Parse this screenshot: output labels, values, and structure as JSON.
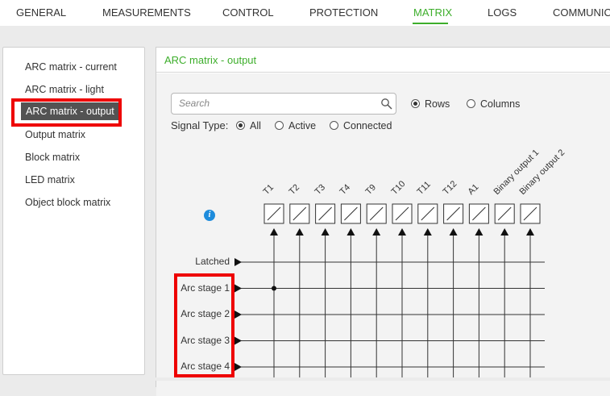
{
  "top_tabs": [
    {
      "label": "GENERAL",
      "active": false
    },
    {
      "label": "MEASUREMENTS",
      "active": false
    },
    {
      "label": "CONTROL",
      "active": false
    },
    {
      "label": "PROTECTION",
      "active": false
    },
    {
      "label": "MATRIX",
      "active": true
    },
    {
      "label": "LOGS",
      "active": false
    },
    {
      "label": "COMMUNICA",
      "active": false
    }
  ],
  "sidebar": {
    "items": [
      {
        "label": "ARC matrix - current"
      },
      {
        "label": "ARC matrix - light"
      },
      {
        "label": "ARC matrix - output",
        "selected": true
      },
      {
        "label": "Output matrix"
      },
      {
        "label": "Block matrix"
      },
      {
        "label": "LED matrix"
      },
      {
        "label": "Object block matrix"
      }
    ]
  },
  "panel": {
    "title": "ARC matrix - output"
  },
  "search": {
    "placeholder": "Search",
    "value": ""
  },
  "view_options": {
    "rows_label": "Rows",
    "columns_label": "Columns",
    "selected": "Rows"
  },
  "signal_type": {
    "label": "Signal Type:",
    "options": [
      "All",
      "Active",
      "Connected"
    ],
    "selected": "All"
  },
  "matrix": {
    "columns": [
      "T1",
      "T2",
      "T3",
      "T4",
      "T9",
      "T10",
      "T11",
      "T12",
      "A1",
      "Binary output 1",
      "Binary output 2"
    ],
    "rows": [
      "Latched",
      "Arc stage 1",
      "Arc stage 2",
      "Arc stage 3",
      "Arc stage 4"
    ],
    "connections": [
      {
        "row": "Arc stage 1",
        "column": "T1"
      }
    ]
  },
  "colors": {
    "accent": "#3dae2b",
    "highlight": "#e00000",
    "selected_bg": "#535353",
    "info": "#1e8cdc"
  }
}
